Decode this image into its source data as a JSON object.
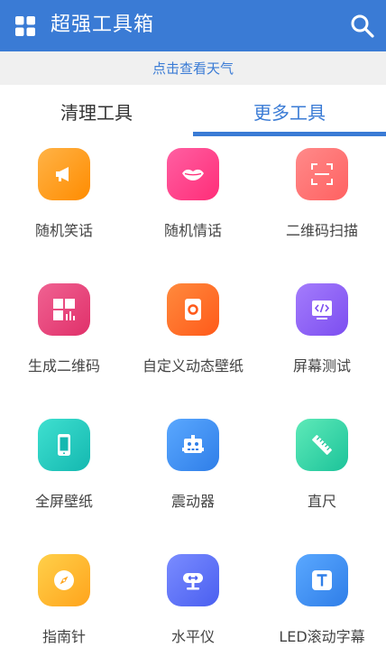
{
  "header": {
    "title": "超强工具箱",
    "menu_icon": "grid-menu-icon",
    "search_icon": "search-icon",
    "color": "#3a7bd5"
  },
  "weather_link": "点击查看天气",
  "tabs": [
    {
      "label": "清理工具",
      "active": false
    },
    {
      "label": "更多工具",
      "active": true
    }
  ],
  "tools": [
    {
      "label": "随机笑话",
      "icon": "megaphone-icon",
      "color": "#ff9f1c"
    },
    {
      "label": "随机情话",
      "icon": "lips-icon",
      "color": "#ff3d8b"
    },
    {
      "label": "二维码扫描",
      "icon": "scan-frame-icon",
      "color": "#ff6b6b"
    },
    {
      "label": "生成二维码",
      "icon": "qr-generate-icon",
      "color": "#e8457c"
    },
    {
      "label": "自定义动态壁纸",
      "icon": "wallpaper-icon",
      "color": "#ff6a2b"
    },
    {
      "label": "屏幕测试",
      "icon": "code-screen-icon",
      "color": "#8b5cf6"
    },
    {
      "label": "全屏壁纸",
      "icon": "phone-icon",
      "color": "#22c7c0"
    },
    {
      "label": "震动器",
      "icon": "robot-icon",
      "color": "#3b8ef0"
    },
    {
      "label": "直尺",
      "icon": "ruler-icon",
      "color": "#2ed1a2"
    },
    {
      "label": "指南针",
      "icon": "compass-icon",
      "color": "#ffb21c"
    },
    {
      "label": "水平仪",
      "icon": "level-icon",
      "color": "#5a74f5"
    },
    {
      "label": "LED滚动字幕",
      "icon": "text-t-icon",
      "color": "#3b8ef0"
    }
  ]
}
